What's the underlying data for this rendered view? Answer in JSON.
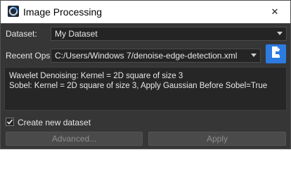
{
  "window": {
    "title": "Image Processing",
    "close_glyph": "✕"
  },
  "dataset": {
    "label": "Dataset:",
    "selected": "My Dataset"
  },
  "recent_ops": {
    "label": "Recent Ops:",
    "selected": "C:/Users/Windows 7/denoise-edge-detection.xml",
    "load_icon": "load-file-icon"
  },
  "operations": {
    "lines": [
      "Wavelet Denoising: Kernel = 2D square of size 3",
      "Sobel: Kernel = 2D square of size 3, Apply Gaussian Before Sobel=True"
    ]
  },
  "create_new_dataset": {
    "label": "Create new dataset",
    "checked": true
  },
  "buttons": {
    "advanced": "Advanced...",
    "apply": "Apply"
  },
  "colors": {
    "accent": "#2c7be0",
    "background": "#363636"
  }
}
